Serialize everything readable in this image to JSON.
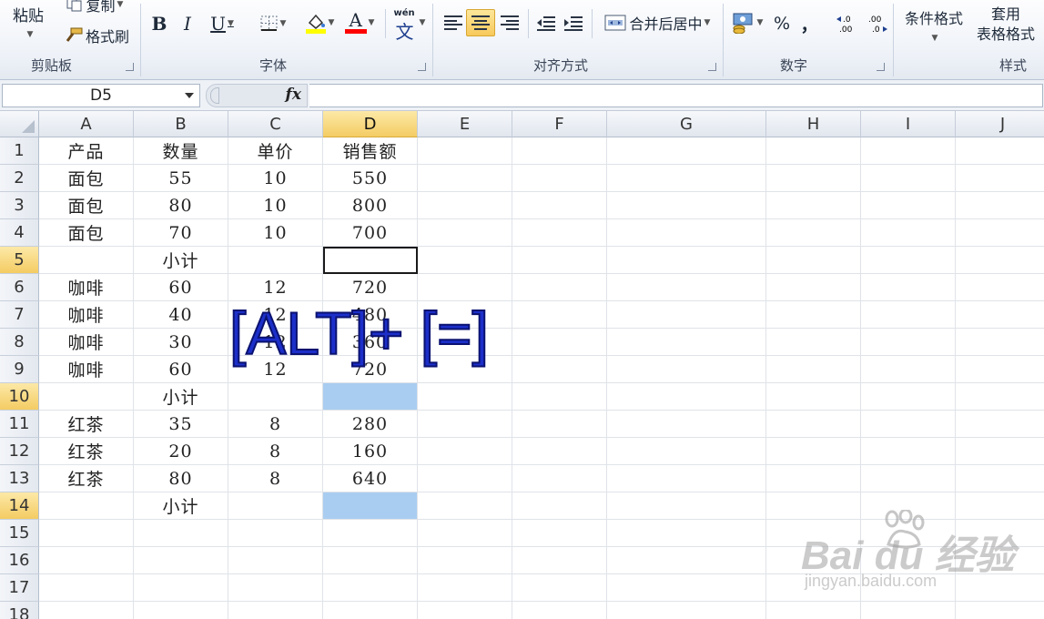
{
  "ribbon": {
    "clipboard": {
      "paste": "粘贴",
      "copy": "复制",
      "format_painter": "格式刷",
      "label": "剪贴板"
    },
    "font": {
      "bold": "B",
      "italic": "I",
      "underline": "U",
      "font_color_letter": "A",
      "phonetic_top": "wén",
      "phonetic_char": "文",
      "label": "字体"
    },
    "alignment": {
      "merge_center": "合并后居中",
      "label": "对齐方式"
    },
    "number": {
      "percent": "%",
      "comma": "，",
      "inc_decimal": "←.0\n.00",
      "dec_decimal": ".00\n→.0",
      "label": "数字"
    },
    "styles": {
      "conditional_format": "条件格式",
      "table_format_1": "套用",
      "table_format_2": "表格格式",
      "label": "样式"
    }
  },
  "formula_bar": {
    "name_box": "D5",
    "fx": "fx",
    "formula": ""
  },
  "columns": [
    "A",
    "B",
    "C",
    "D",
    "E",
    "F",
    "G",
    "H",
    "I",
    "J"
  ],
  "selected_column": "D",
  "rows": [
    {
      "n": "1",
      "cells": [
        "产品",
        "数量",
        "单价",
        "销售额"
      ]
    },
    {
      "n": "2",
      "cells": [
        "面包",
        "55",
        "10",
        "550"
      ]
    },
    {
      "n": "3",
      "cells": [
        "面包",
        "80",
        "10",
        "800"
      ]
    },
    {
      "n": "4",
      "cells": [
        "面包",
        "70",
        "10",
        "700"
      ]
    },
    {
      "n": "5",
      "cells": [
        "",
        "小计",
        "",
        ""
      ]
    },
    {
      "n": "6",
      "cells": [
        "咖啡",
        "60",
        "12",
        "720"
      ]
    },
    {
      "n": "7",
      "cells": [
        "咖啡",
        "40",
        "12",
        "480"
      ]
    },
    {
      "n": "8",
      "cells": [
        "咖啡",
        "30",
        "12",
        "360"
      ]
    },
    {
      "n": "9",
      "cells": [
        "咖啡",
        "60",
        "12",
        "720"
      ]
    },
    {
      "n": "10",
      "cells": [
        "",
        "小计",
        "",
        ""
      ]
    },
    {
      "n": "11",
      "cells": [
        "红茶",
        "35",
        "8",
        "280"
      ]
    },
    {
      "n": "12",
      "cells": [
        "红茶",
        "20",
        "8",
        "160"
      ]
    },
    {
      "n": "13",
      "cells": [
        "红茶",
        "80",
        "8",
        "640"
      ]
    },
    {
      "n": "14",
      "cells": [
        "",
        "小计",
        "",
        ""
      ]
    },
    {
      "n": "15",
      "cells": [
        "",
        "",
        "",
        ""
      ]
    },
    {
      "n": "16",
      "cells": [
        "",
        "",
        "",
        ""
      ]
    },
    {
      "n": "17",
      "cells": [
        "",
        "",
        "",
        ""
      ]
    },
    {
      "n": "18",
      "cells": [
        "",
        "",
        "",
        ""
      ]
    }
  ],
  "selected_rows": [
    "5",
    "10",
    "14"
  ],
  "active_cell": "D5",
  "highlighted_cells": [
    "D10",
    "D14"
  ],
  "colors": {
    "selection_fill": "#a9cdf0",
    "overlay_text": "#1c2fc9",
    "header_selected": "#f4cc63"
  },
  "overlay": {
    "shortcut": "[ALT]+ [=]"
  },
  "watermark": {
    "logo": "Bai du 经验",
    "url": "jingyan.baidu.com"
  }
}
